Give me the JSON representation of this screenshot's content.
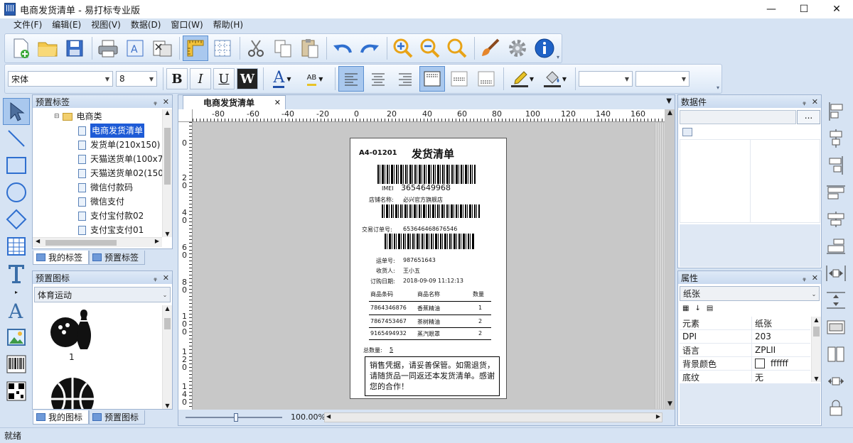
{
  "window": {
    "title": "电商发货清单 - 易打标专业版",
    "minimize": "—",
    "maximize": "☐",
    "close": "✕"
  },
  "menu": [
    "文件(F)",
    "编辑(E)",
    "视图(V)",
    "数据(D)",
    "窗口(W)",
    "帮助(H)"
  ],
  "format_bar": {
    "font": "宋体",
    "size": "8",
    "bold": "B",
    "italic": "I",
    "underline": "U",
    "wrap": "W",
    "font_color": "A",
    "highlight": "AB",
    "combo3": "",
    "combo4": ""
  },
  "preset_labels": {
    "title": "预置标签",
    "root": "电商类",
    "items": [
      "电商发货清单",
      "发货单(210x150)",
      "天猫送货单(100x7",
      "天猫送货单02(150",
      "微信付款码",
      "微信支付",
      "支付宝付款02",
      "支付宝支付01"
    ],
    "tab_mine": "我的标签",
    "tab_preset": "预置标签"
  },
  "preset_icons": {
    "title": "预置图标",
    "category": "体育运动",
    "first_caption": "1",
    "tab_mine": "我的图标",
    "tab_preset": "预置图标"
  },
  "editor": {
    "tab": "电商发货清单",
    "ruler_h": [
      "-80",
      "-60",
      "-40",
      "-20",
      "0",
      "20",
      "40",
      "60",
      "80",
      "100",
      "120",
      "140",
      "160"
    ],
    "ruler_v": [
      "0",
      "2\n0",
      "4\n0",
      "6\n0",
      "8\n0",
      "1\n0\n0",
      "1\n2\n0",
      "1\n4\n0"
    ],
    "zoom": "100.00%"
  },
  "label": {
    "code": "A4-01201",
    "title": "发货清单",
    "imei_label": "IMEI",
    "imei": "3654649968",
    "shop_label": "店铺名称:",
    "shop": "必兴官方旗舰店",
    "order_label": "交易订单号:",
    "order_no": "653646468676546",
    "waybill_label": "运单号:",
    "waybill": "987651643",
    "receiver_label": "收货人:",
    "receiver": "王小五",
    "date_label": "订购日期:",
    "date": "2018-09-09 11:12:13",
    "col_code": "商品条码",
    "col_name": "商品名称",
    "col_qty": "数量",
    "rows": [
      {
        "code": "7864346876",
        "name": "香蕉精油",
        "qty": "1"
      },
      {
        "code": "7867453467",
        "name": "茶树精油",
        "qty": "2"
      },
      {
        "code": "9165494932",
        "name": "蒸汽眼罩",
        "qty": "2"
      }
    ],
    "total_label": "总数量:",
    "total": "5",
    "note": "销售凭据，请妥善保管。如需退货，请随货品一同返还本发货清单。感谢您的合作！"
  },
  "data_panel": {
    "title": "数据件",
    "browse": "..."
  },
  "props_panel": {
    "title": "属性",
    "object": "纸张",
    "rows": [
      {
        "k": "元素",
        "v": "纸张"
      },
      {
        "k": "DPI",
        "v": "203"
      },
      {
        "k": "语言",
        "v": "ZPLII"
      },
      {
        "k": "背景颜色",
        "v": "ffffff"
      },
      {
        "k": "底纹",
        "v": "无"
      }
    ]
  },
  "status": "就绪"
}
